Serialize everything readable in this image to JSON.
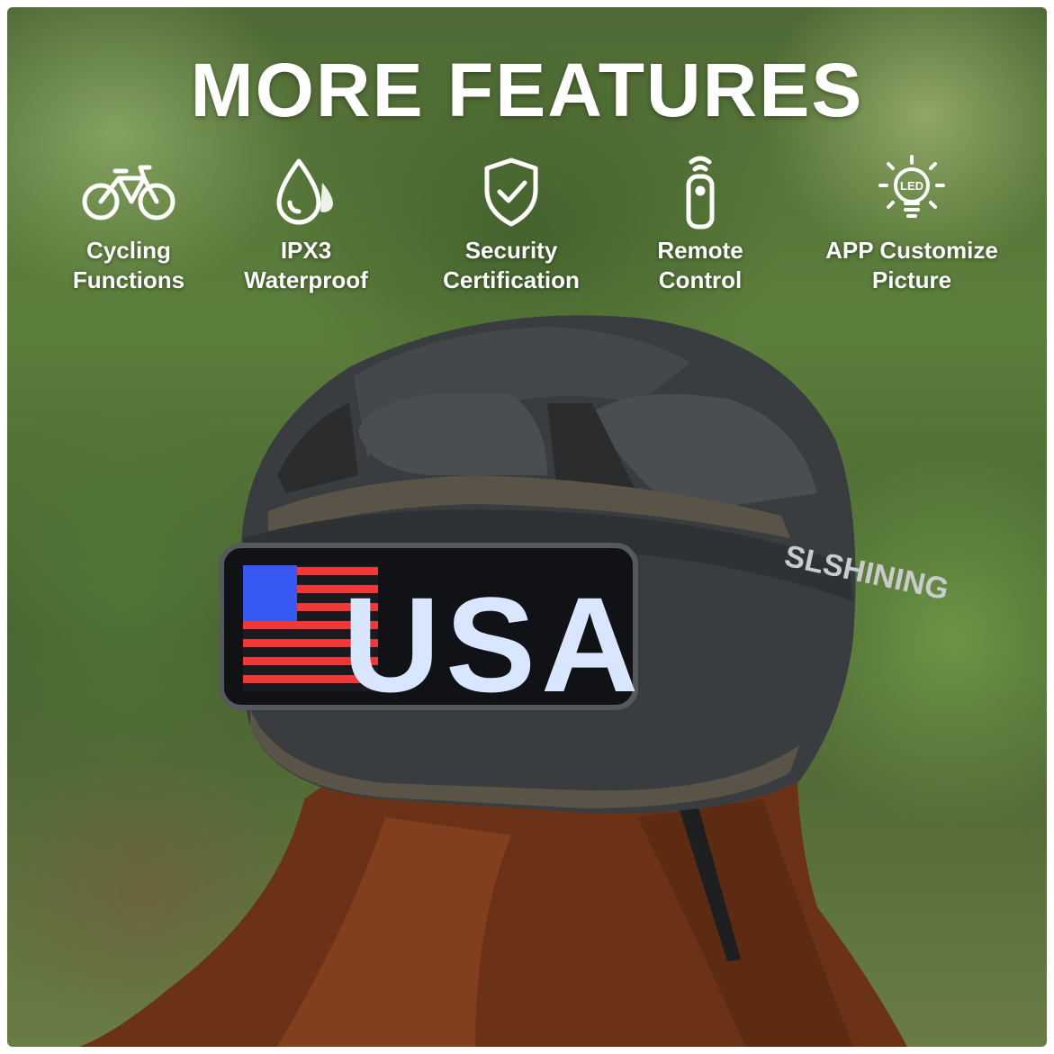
{
  "title": "MORE FEATURES",
  "features": [
    {
      "icon": "bicycle-icon",
      "line1": "Cycling",
      "line2": "Functions"
    },
    {
      "icon": "water-drop-icon",
      "line1": "IPX3",
      "line2": "Waterproof"
    },
    {
      "icon": "shield-check-icon",
      "line1": "Security",
      "line2": "Certification"
    },
    {
      "icon": "remote-control-icon",
      "line1": "Remote",
      "line2": "Control"
    },
    {
      "icon": "led-bulb-icon",
      "line1": "APP Customize",
      "line2": "Picture"
    }
  ],
  "led_icon_text": "LED",
  "helmet": {
    "brand": "SLSHINING",
    "display_text": "USA"
  },
  "colors": {
    "text": "#ffffff",
    "helmet": "#3a3d40",
    "led_blue": "#d8e6ff",
    "led_red": "#ff3a3a"
  }
}
